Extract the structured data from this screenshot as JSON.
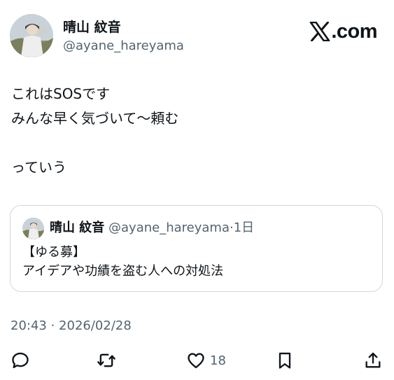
{
  "author": {
    "display_name": "晴山 紋音",
    "handle": "@ayane_hareyama"
  },
  "brand": {
    "icon": "x-logo-icon",
    "text": ".com"
  },
  "tweet": {
    "lines": [
      "これはSOSです",
      "みんな早く気づいて〜頼む",
      "",
      "っていう"
    ]
  },
  "quoted_tweet": {
    "display_name": "晴山 紋音",
    "handle": "@ayane_hareyama",
    "separator": "·",
    "time": "1日",
    "lines": [
      "【ゆる募】",
      "アイデアや功績を盗む人への対処法"
    ]
  },
  "timestamp": "20:43 · 2026/02/28",
  "actions": {
    "reply": {
      "icon": "reply-icon"
    },
    "retweet": {
      "icon": "retweet-icon"
    },
    "like": {
      "icon": "heart-icon",
      "count": "18"
    },
    "bookmark": {
      "icon": "bookmark-icon"
    },
    "share": {
      "icon": "share-icon"
    }
  },
  "colors": {
    "text_primary": "#0f1419",
    "text_secondary": "#536471",
    "border": "#cfd9de"
  }
}
